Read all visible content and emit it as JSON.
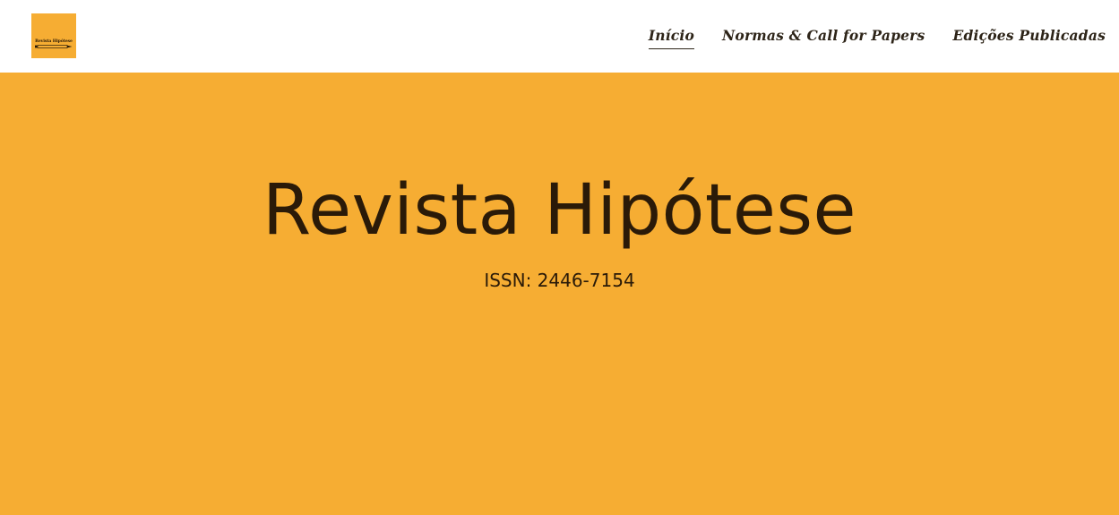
{
  "header": {
    "logo": {
      "text": "Revista Hipótese",
      "icon": "pencil-icon"
    },
    "nav": [
      {
        "label": "Início",
        "active": true
      },
      {
        "label": "Normas & Call for Papers",
        "active": false
      },
      {
        "label": "Edições Publicadas",
        "active": false
      }
    ]
  },
  "hero": {
    "title": "Revista Hipótese",
    "subtitle": "ISSN: 2446-7154"
  },
  "colors": {
    "accent": "#f6ad33",
    "text": "#2a1a08",
    "header_bg": "#ffffff"
  }
}
